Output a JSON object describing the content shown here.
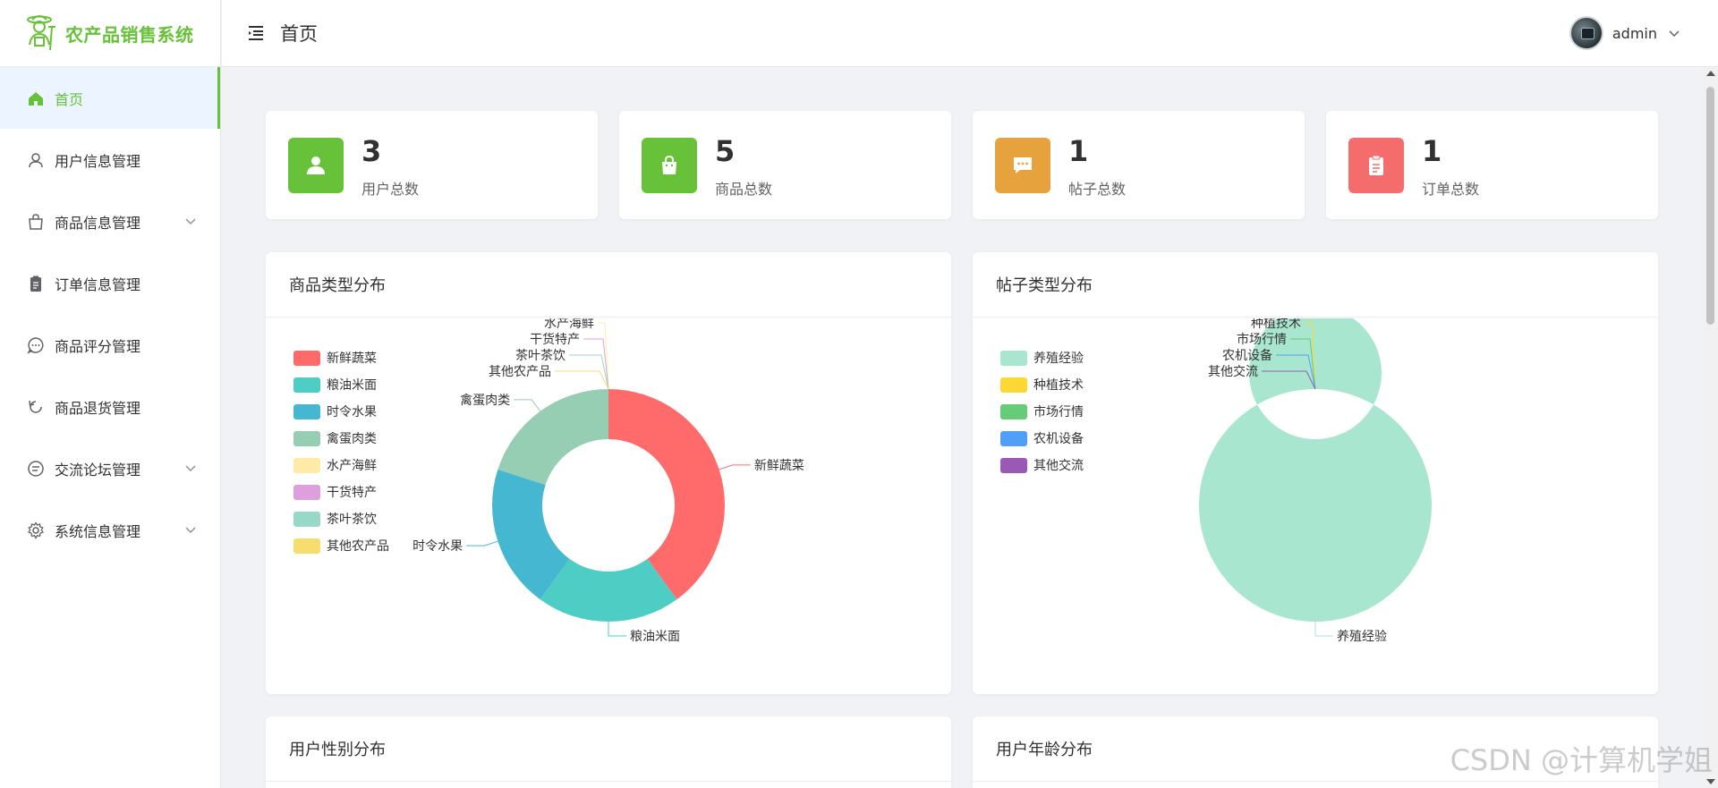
{
  "app": {
    "title": "农产品销售系统"
  },
  "header": {
    "page_title": "首页",
    "username": "admin"
  },
  "sidebar": {
    "items": [
      {
        "label": "首页",
        "icon": "home-icon",
        "active": true,
        "expandable": false
      },
      {
        "label": "用户信息管理",
        "icon": "user-icon",
        "expandable": false
      },
      {
        "label": "商品信息管理",
        "icon": "shopping-bag-icon",
        "expandable": true
      },
      {
        "label": "订单信息管理",
        "icon": "clipboard-icon",
        "expandable": false
      },
      {
        "label": "商品评分管理",
        "icon": "chat-dots-icon",
        "expandable": false
      },
      {
        "label": "商品退货管理",
        "icon": "refresh-icon",
        "expandable": false
      },
      {
        "label": "交流论坛管理",
        "icon": "chat-lines-icon",
        "expandable": true
      },
      {
        "label": "系统信息管理",
        "icon": "gear-icon",
        "expandable": true
      }
    ]
  },
  "stats": [
    {
      "value": "3",
      "label": "用户总数",
      "color": "#67c23a",
      "icon": "user-icon"
    },
    {
      "value": "5",
      "label": "商品总数",
      "color": "#67c23a",
      "icon": "shopping-bag-icon"
    },
    {
      "value": "1",
      "label": "帖子总数",
      "color": "#e6a23c",
      "icon": "chat-bubble-icon"
    },
    {
      "value": "1",
      "label": "订单总数",
      "color": "#f56c6c",
      "icon": "clipboard-icon"
    }
  ],
  "cards": {
    "product_types": {
      "title": "商品类型分布"
    },
    "post_types": {
      "title": "帖子类型分布"
    },
    "user_gender": {
      "title": "用户性别分布"
    },
    "user_age": {
      "title": "用户年龄分布"
    }
  },
  "chart_data": [
    {
      "type": "pie",
      "title": "商品类型分布",
      "legend_position": "left",
      "categories": [
        "新鲜蔬菜",
        "粮油米面",
        "时令水果",
        "禽蛋肉类",
        "水产海鲜",
        "干货特产",
        "茶叶茶饮",
        "其他农产品"
      ],
      "values": [
        2,
        1,
        1,
        1,
        0,
        0,
        0,
        0
      ],
      "colors": [
        "#ff6b6b",
        "#4ecdc4",
        "#45b7d1",
        "#96ceb4",
        "#ffeaa7",
        "#dda0dd",
        "#98d8c8",
        "#f7dc6f"
      ]
    },
    {
      "type": "pie",
      "title": "帖子类型分布",
      "legend_position": "left",
      "categories": [
        "养殖经验",
        "种植技术",
        "市场行情",
        "农机设备",
        "其他交流"
      ],
      "values": [
        1,
        0,
        0,
        0,
        0
      ],
      "colors": [
        "#a8e6cf",
        "#fdd835",
        "#66cc77",
        "#4f9ff8",
        "#9b59b6"
      ]
    }
  ],
  "watermark": "CSDN @计算机学姐"
}
